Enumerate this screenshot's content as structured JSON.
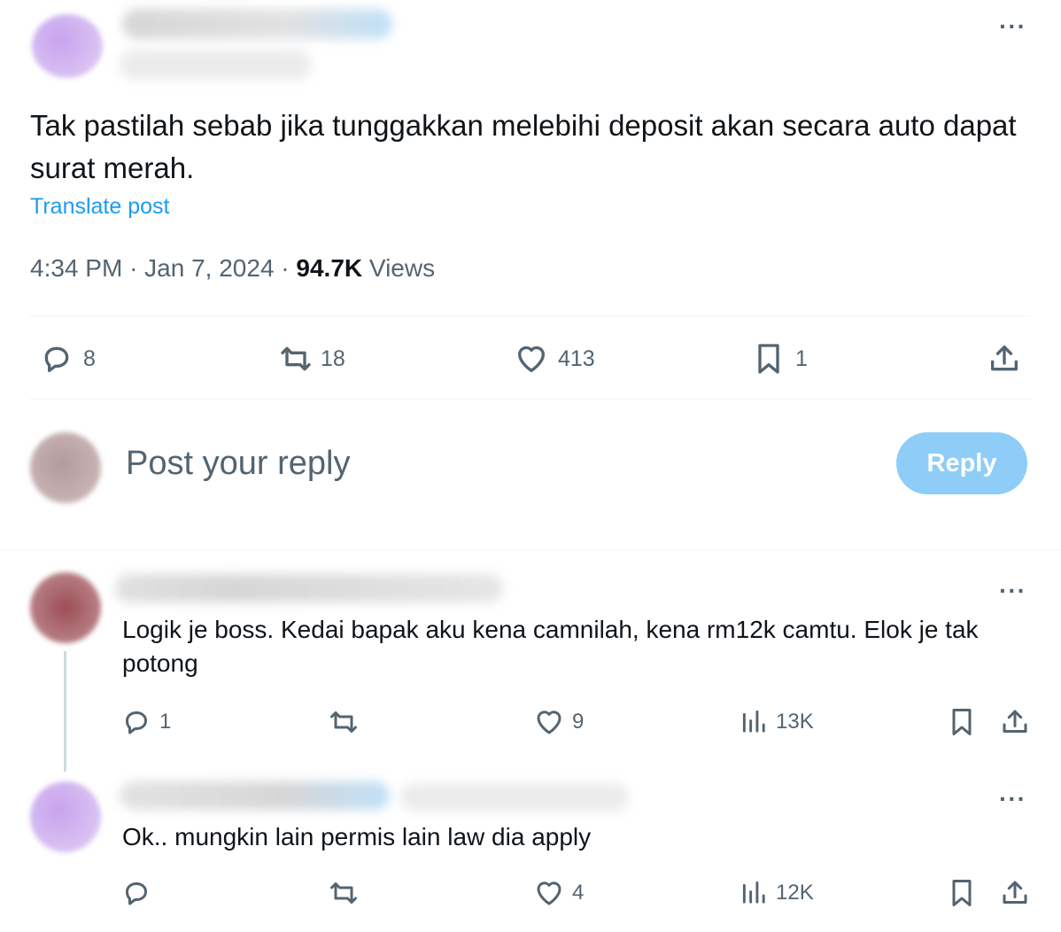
{
  "main_post": {
    "text": "Tak pastilah sebab jika tunggakkan melebihi deposit akan secara auto dapat surat merah.",
    "translate_label": "Translate post",
    "time": "4:34 PM",
    "sep1": "·",
    "date": "Jan 7, 2024",
    "sep2": "·",
    "views_count": "94.7K",
    "views_label": "Views",
    "more_icon": "more-dots-icon",
    "actions": {
      "replies": "8",
      "reposts": "18",
      "likes": "413",
      "bookmarks": "1"
    }
  },
  "composer": {
    "placeholder": "Post your reply",
    "reply_button": "Reply",
    "reply_button_color": "#8ecdf8"
  },
  "replies": [
    {
      "text": "Logik je boss. Kedai bapak aku kena camnilah, kena rm12k camtu. Elok je tak potong",
      "reply_count": "1",
      "repost_count": "",
      "like_count": "9",
      "view_count": "13K"
    },
    {
      "text": "Ok.. mungkin lain permis lain law dia apply",
      "reply_count": "",
      "repost_count": "",
      "like_count": "4",
      "view_count": "12K"
    }
  ],
  "colors": {
    "accent": "#1d9bf0",
    "text_primary": "#0f1419",
    "text_secondary": "#536471",
    "divider": "#eff3f4"
  }
}
